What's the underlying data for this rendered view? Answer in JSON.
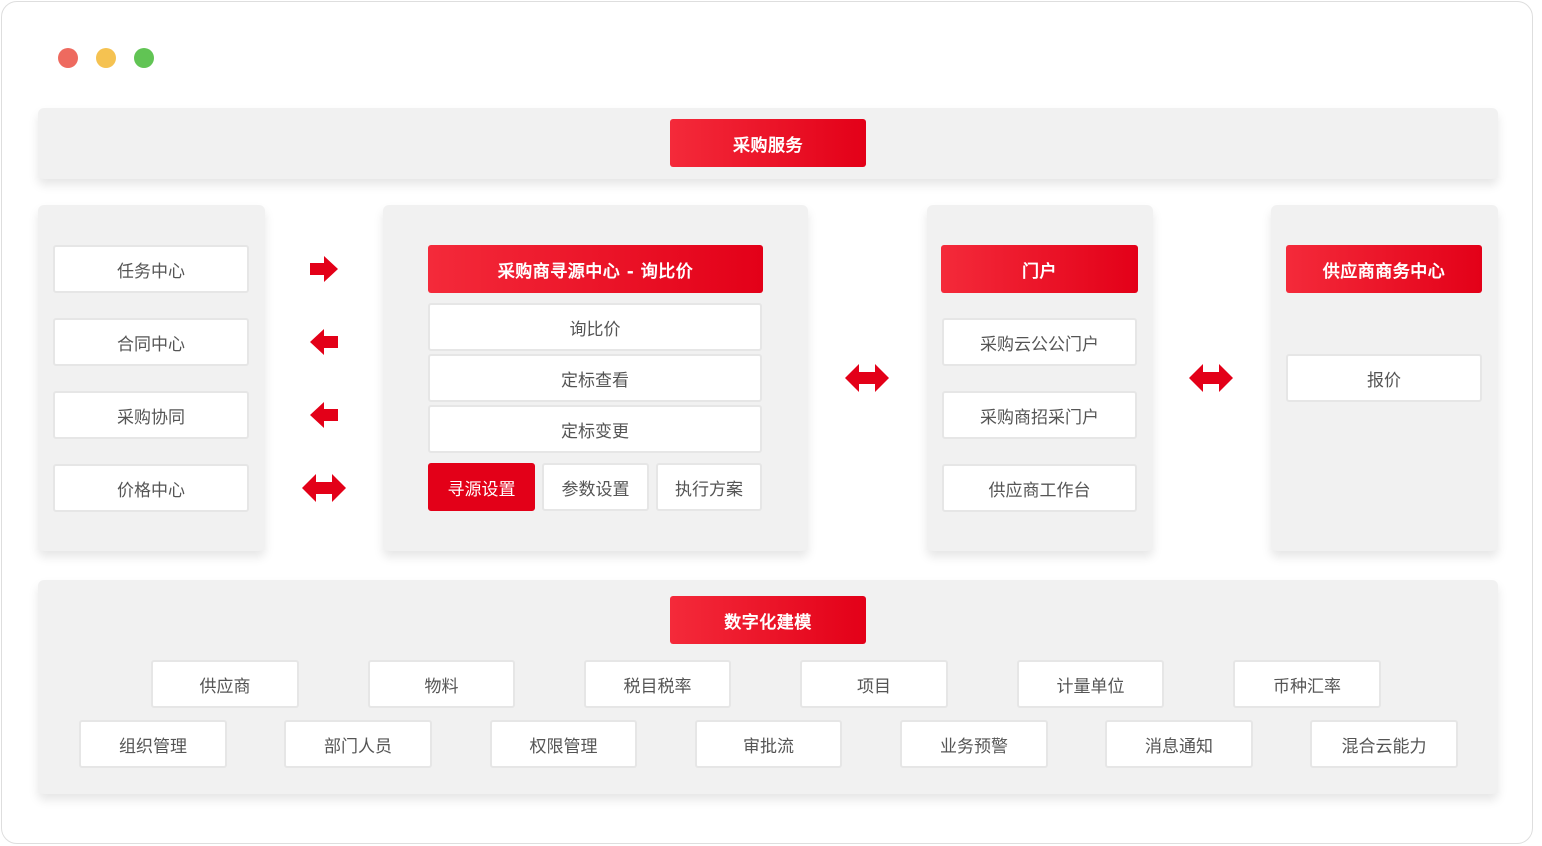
{
  "colors": {
    "accent": "#e30018",
    "panel": "#f1f1f1",
    "border": "#e6e6e6"
  },
  "window_controls": [
    "close",
    "minimize",
    "maximize"
  ],
  "top": {
    "title": "采购服务"
  },
  "left": {
    "items": [
      "任务中心",
      "合同中心",
      "采购协同",
      "价格中心"
    ]
  },
  "sourcing": {
    "title": "采购商寻源中心 - 询比价",
    "items": [
      "询比价",
      "定标查看",
      "定标变更"
    ],
    "buttons": [
      "寻源设置",
      "参数设置",
      "执行方案"
    ]
  },
  "portal": {
    "title": "门户",
    "items": [
      "采购云公公门户",
      "采购商招采门户",
      "供应商工作台"
    ]
  },
  "supplier": {
    "title": "供应商商务中心",
    "items": [
      "报价"
    ]
  },
  "modeling": {
    "title": "数字化建模",
    "row1": [
      "供应商",
      "物料",
      "税目税率",
      "项目",
      "计量单位",
      "币种汇率"
    ],
    "row2": [
      "组织管理",
      "部门人员",
      "权限管理",
      "审批流",
      "业务预警",
      "消息通知",
      "混合云能力"
    ]
  }
}
